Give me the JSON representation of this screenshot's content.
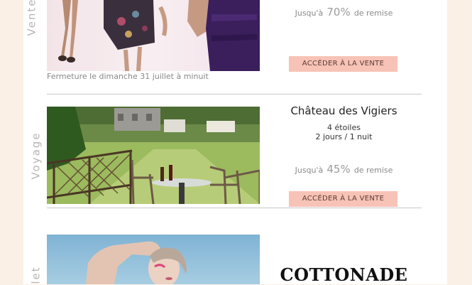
{
  "sale1": {
    "category": "Vente",
    "discount_prefix": "Jusqu'à",
    "discount_value": "70%",
    "discount_suffix": "de remise",
    "cta": "ACCÉDER À LA VENTE",
    "closing": "Fermeture le dimanche 31 juillet à minuit"
  },
  "sale2": {
    "category": "Voyage",
    "title": "Château des Vigiers",
    "rating": "4 étoiles",
    "duration": "2 jours / 1 nuit",
    "discount_prefix": "Jusqu'à",
    "discount_value": "45%",
    "discount_suffix": "de remise",
    "cta": "ACCÉDER À LA VENTE"
  },
  "sale3": {
    "category": "let",
    "brand": "COTTONADE"
  },
  "colors": {
    "cta_bg": "#f7c3b6",
    "page_bg": "#fbf0e6"
  }
}
